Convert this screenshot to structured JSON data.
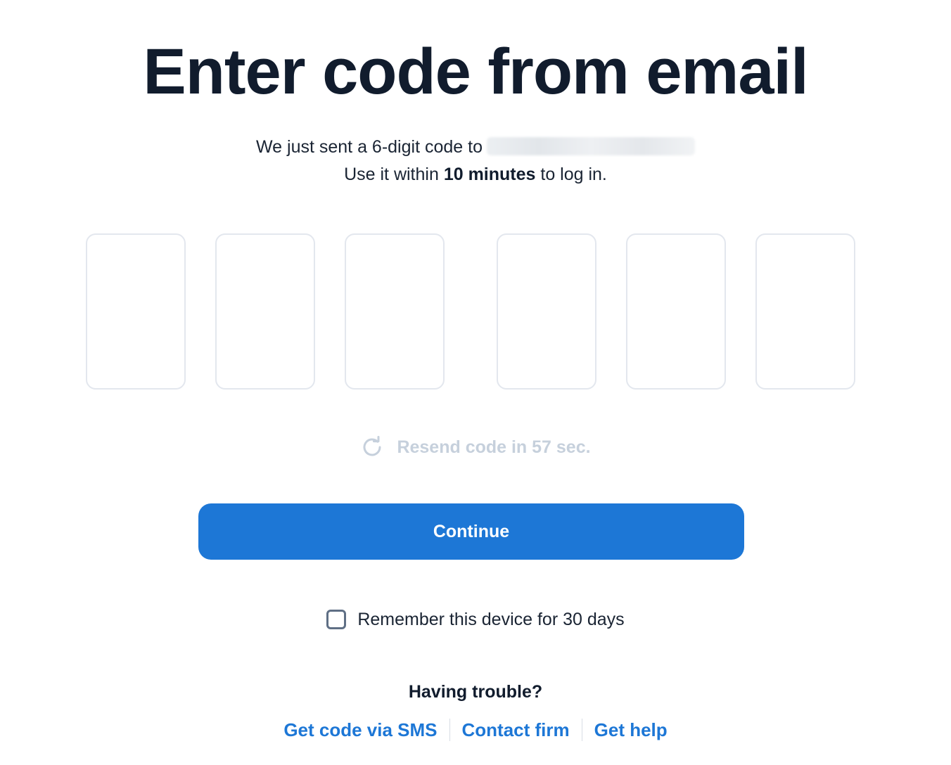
{
  "page": {
    "title": "Enter code from email",
    "sent_text": "We just sent a 6-digit code to",
    "use_prefix": "Use it within",
    "use_bold": "10 minutes",
    "use_suffix": "to log in."
  },
  "code_inputs": {
    "count": 6,
    "values": [
      "",
      "",
      "",
      "",
      "",
      ""
    ]
  },
  "resend": {
    "icon": "refresh-icon",
    "label": "Resend code in 57 sec."
  },
  "continue_button": {
    "label": "Continue",
    "color": "#1d77d6"
  },
  "remember": {
    "label": "Remember this device for 30 days",
    "checked": false
  },
  "help": {
    "heading": "Having trouble?",
    "links": [
      "Get code via SMS",
      "Contact firm",
      "Get help"
    ]
  },
  "colors": {
    "heading": "#111c2d",
    "accent": "#1d77d6",
    "disabled_text": "#c6d0dc",
    "input_border": "#e3e7ee"
  }
}
